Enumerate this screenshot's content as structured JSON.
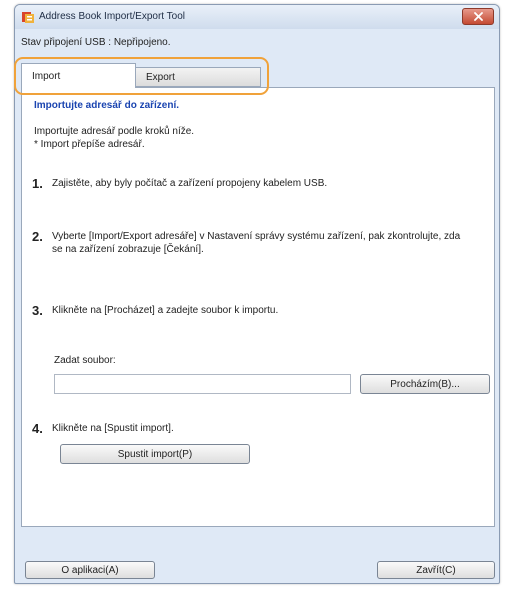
{
  "window": {
    "title": "Address Book Import/Export Tool",
    "status": "Stav připojení USB : Nepřipojeno."
  },
  "tabs": [
    {
      "label": "Import",
      "selected": true
    },
    {
      "label": "Export",
      "selected": false
    }
  ],
  "panel": {
    "heading": "Importujte adresář do zařízení.",
    "intro": [
      "Importujte adresář podle kroků níže.",
      "* Import přepíše adresář."
    ],
    "steps": [
      {
        "number": "1.",
        "text": "Zajistěte, aby byly počítač a zařízení propojeny kabelem USB."
      },
      {
        "number": "2.",
        "text": "Vyberte [Import/Export adresáře] v Nastavení správy systému zařízení, pak zkontrolujte, zda se na zařízení zobrazuje [Čekání]."
      },
      {
        "number": "3.",
        "text": "Klikněte na [Procházet] a zadejte soubor k importu."
      },
      {
        "number": "4.",
        "text": "Klikněte na [Spustit import]."
      }
    ],
    "file_label": "Zadat soubor:",
    "file_value": "",
    "browse_label": "Procházím(B)...",
    "start_label": "Spustit import(P)"
  },
  "footer": {
    "about_label": "O aplikaci(A)",
    "close_label": "Zavřít(C)"
  },
  "colors": {
    "heading": "#1a44b0",
    "tab_highlight": "#f0a23a",
    "window_bg": "#dfe9f6"
  }
}
